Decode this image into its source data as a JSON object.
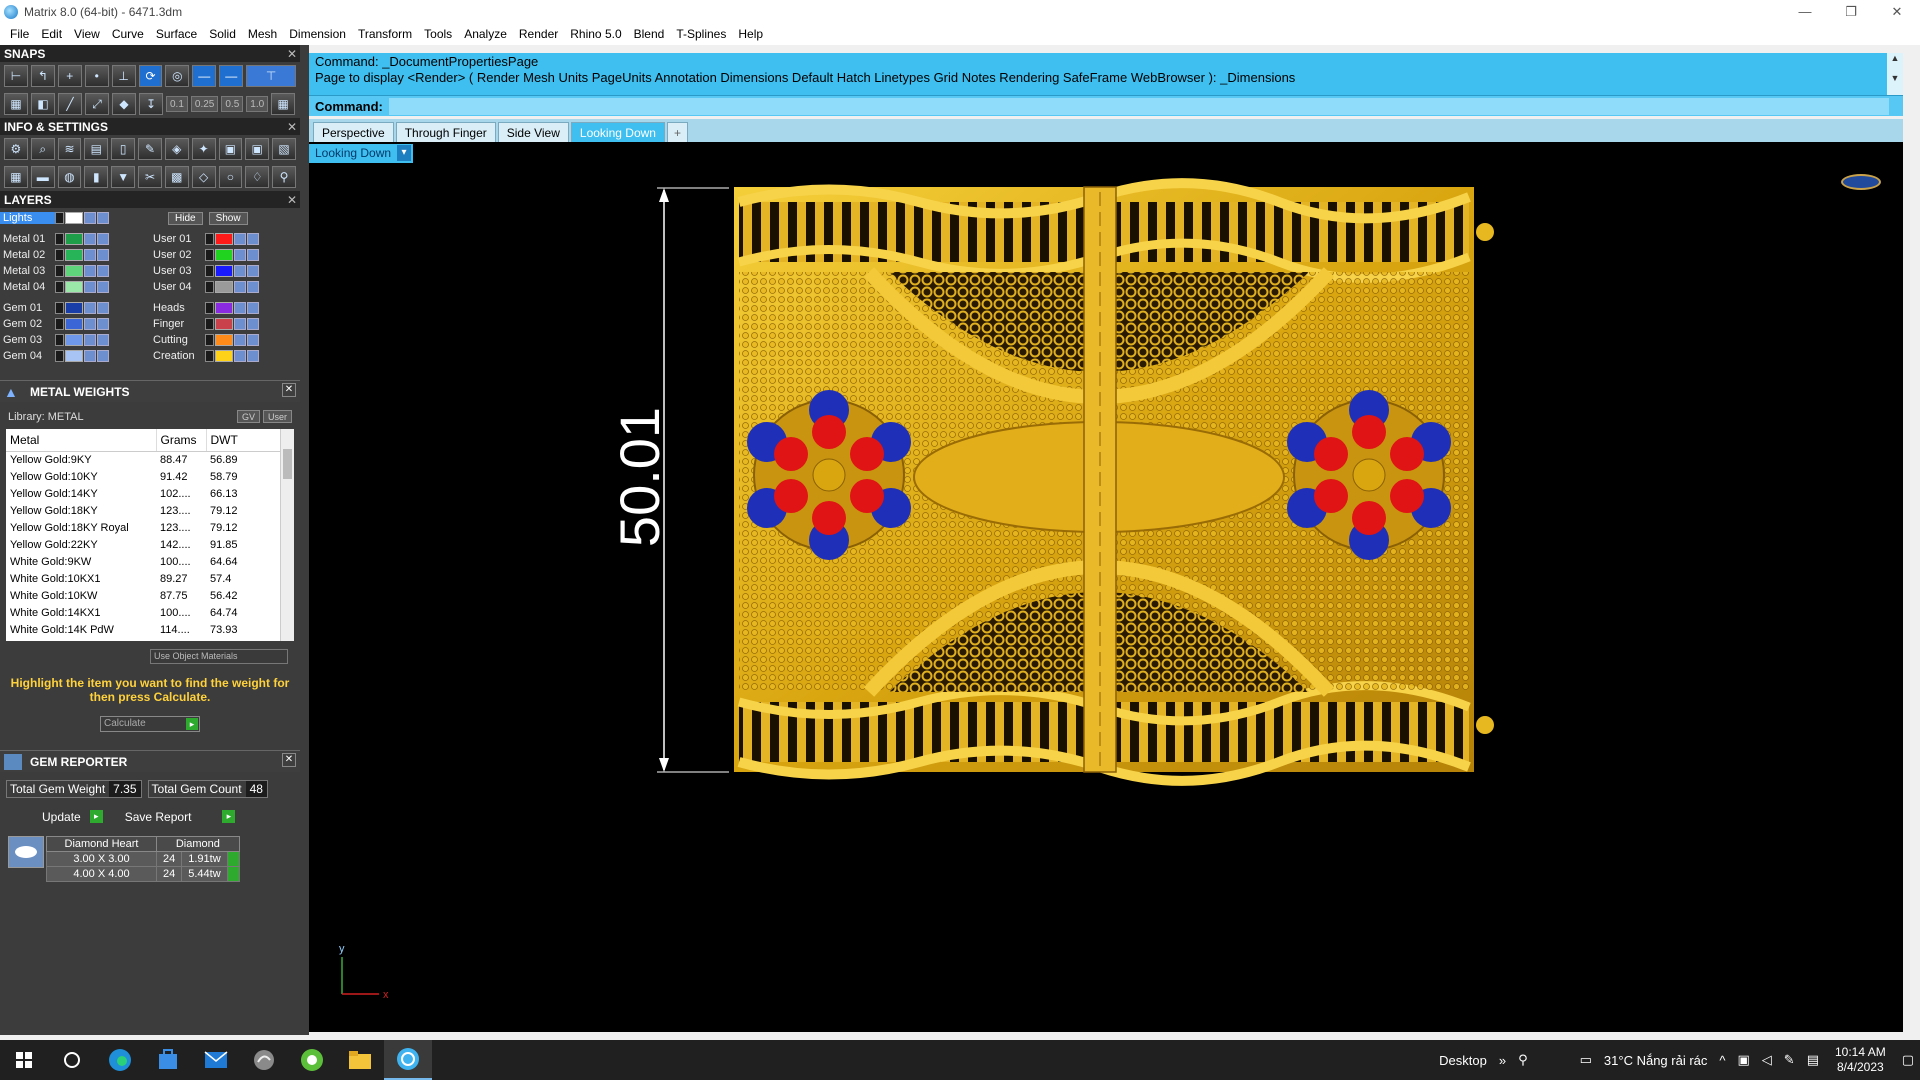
{
  "window": {
    "title": "Matrix 8.0 (64-bit) - 6471.3dm",
    "minimize": "—",
    "restore": "❐",
    "close": "✕"
  },
  "menu": [
    "File",
    "Edit",
    "View",
    "Curve",
    "Surface",
    "Solid",
    "Mesh",
    "Dimension",
    "Transform",
    "Tools",
    "Analyze",
    "Render",
    "Rhino 5.0",
    "Blend",
    "T-Splines",
    "Help"
  ],
  "snaps": {
    "header": "SNAPS",
    "values": [
      "0.1",
      "0.25",
      "0.5",
      "1.0"
    ]
  },
  "info_settings": {
    "header": "INFO & SETTINGS"
  },
  "layers": {
    "header": "LAYERS",
    "hide_label": "Hide",
    "show_label": "Show",
    "lights_label": "Lights",
    "left": [
      {
        "name": "Metal 01",
        "color": "#1f9e4a"
      },
      {
        "name": "Metal 02",
        "color": "#27b357"
      },
      {
        "name": "Metal 03",
        "color": "#5fd47b"
      },
      {
        "name": "Metal 04",
        "color": "#9be6a9"
      }
    ],
    "right": [
      {
        "name": "User 01",
        "color": "#ff1a1a"
      },
      {
        "name": "User 02",
        "color": "#1fd31f"
      },
      {
        "name": "User 03",
        "color": "#1a1aff"
      },
      {
        "name": "User 04",
        "color": "#9a9a9a"
      }
    ],
    "left2": [
      {
        "name": "Gem 01",
        "color": "#1a3ea8"
      },
      {
        "name": "Gem 02",
        "color": "#3a66d6"
      },
      {
        "name": "Gem 03",
        "color": "#6f97ea"
      },
      {
        "name": "Gem 04",
        "color": "#a8c4f5"
      }
    ],
    "right2": [
      {
        "name": "Heads",
        "color": "#8a2be2"
      },
      {
        "name": "Finger",
        "color": "#c8414b"
      },
      {
        "name": "Cutting",
        "color": "#ff8c1a"
      },
      {
        "name": "Creation",
        "color": "#ffd21a"
      }
    ]
  },
  "metal_weights": {
    "header": "METAL WEIGHTS",
    "library": "Library: METAL",
    "gv_label": "GV",
    "user_label": "User",
    "columns": [
      "Metal",
      "Grams",
      "DWT"
    ],
    "rows": [
      [
        "Yellow Gold:9KY",
        "88.47",
        "56.89"
      ],
      [
        "Yellow Gold:10KY",
        "91.42",
        "58.79"
      ],
      [
        "Yellow Gold:14KY",
        "102....",
        "66.13"
      ],
      [
        "Yellow Gold:18KY",
        "123....",
        "79.12"
      ],
      [
        "Yellow Gold:18KY Royal",
        "123....",
        "79.12"
      ],
      [
        "Yellow Gold:22KY",
        "142....",
        "91.85"
      ],
      [
        "White Gold:9KW",
        "100....",
        "64.64"
      ],
      [
        "White Gold:10KX1",
        "89.27",
        "57.4"
      ],
      [
        "White Gold:10KW",
        "87.75",
        "56.42"
      ],
      [
        "White Gold:14KX1",
        "100....",
        "64.74"
      ],
      [
        "White Gold:14K PdW",
        "114....",
        "73.93"
      ]
    ],
    "use_object_materials": "Use Object Materials",
    "hint": "Highlight the item you want to find the weight for then press Calculate.",
    "calculate": "Calculate"
  },
  "gem_reporter": {
    "header": "GEM REPORTER",
    "total_weight_label": "Total Gem Weight",
    "total_weight": "7.35",
    "total_count_label": "Total Gem Count",
    "total_count": "48",
    "update": "Update",
    "save_report": "Save Report",
    "columns": [
      "Diamond Heart",
      "Diamond"
    ],
    "rows": [
      [
        "3.00 X 3.00",
        "24",
        "1.91tw"
      ],
      [
        "4.00 X 4.00",
        "24",
        "5.44tw"
      ]
    ]
  },
  "command": {
    "line1": "Command: _DocumentPropertiesPage",
    "line2": "Page to display <Render> ( Render  Mesh  Units  PageUnits  Annotation  Dimensions  Default  Hatch  Linetypes  Grid  Notes  Rendering  SafeFrame  WebBrowser ): _Dimensions",
    "prompt": "Command:"
  },
  "viewport_tabs": [
    "Perspective",
    "Through Finger",
    "Side View",
    "Looking Down"
  ],
  "active_tab": "Looking Down",
  "viewport": {
    "label": "Looking Down",
    "dimension": "50.01",
    "axis_y": "y",
    "axis_x": "x"
  },
  "taskbar": {
    "desktop": "Desktop",
    "weather": "31°C  Nắng rải rác",
    "time": "10:14 AM",
    "date": "8/4/2023"
  }
}
